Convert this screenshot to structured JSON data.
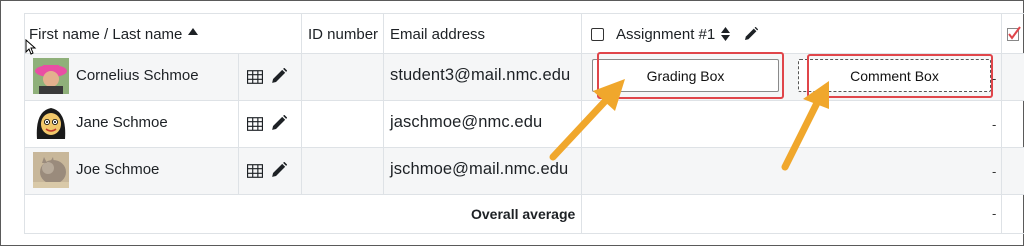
{
  "header": {
    "name_col": "First name / Last name",
    "id_col": "ID number",
    "email_col": "Email address",
    "assignment_col": "Assignment #1"
  },
  "rows": [
    {
      "name": "Cornelius Schmoe",
      "email": "student3@mail.nmc.edu",
      "grade": "-"
    },
    {
      "name": "Jane Schmoe",
      "email": "jaschmoe@nmc.edu",
      "grade": "-"
    },
    {
      "name": "Joe Schmoe",
      "email": "jschmoe@mail.nmc.edu",
      "grade": "-"
    }
  ],
  "grading_box_label": "Grading Box",
  "comment_box_label": "Comment Box",
  "footer": {
    "average_label": "Overall average",
    "average_value": "-"
  },
  "colors": {
    "highlight": "#e0454a",
    "arrow": "#f0a72c",
    "grid": "#dee2e6"
  },
  "icons": [
    "sort-up-icon",
    "sort-both-icon",
    "pencil-icon",
    "grid-report-icon",
    "checkbox-icon",
    "cursor-icon"
  ]
}
